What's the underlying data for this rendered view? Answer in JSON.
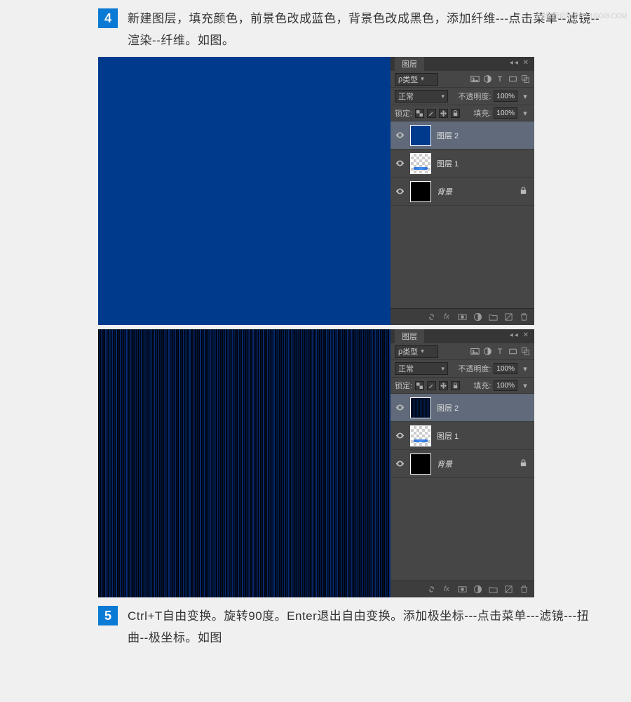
{
  "watermark": "PS教程论坛 BBS.16XX8.COM",
  "steps": {
    "s4": {
      "num": "4",
      "text": "新建图层，填充颜色，前景色改成蓝色，背景色改成黑色，添加纤维---点击菜单--滤镜--渲染--纤维。如图。"
    },
    "s5": {
      "num": "5",
      "text": "Ctrl+T自由变换。旋转90度。Enter退出自由变换。添加极坐标---点击菜单---滤镜---扭曲--极坐标。如图"
    }
  },
  "panel": {
    "tab": "图层",
    "filter_label": "类型",
    "blend": "正常",
    "opacity_label": "不透明度:",
    "opacity_val": "100%",
    "lock_label": "锁定:",
    "fill_label": "填充:",
    "fill_val": "100%",
    "layers": {
      "l2": "图层 2",
      "l1": "图层 1",
      "bg": "背景"
    },
    "fx_label": "fx"
  }
}
